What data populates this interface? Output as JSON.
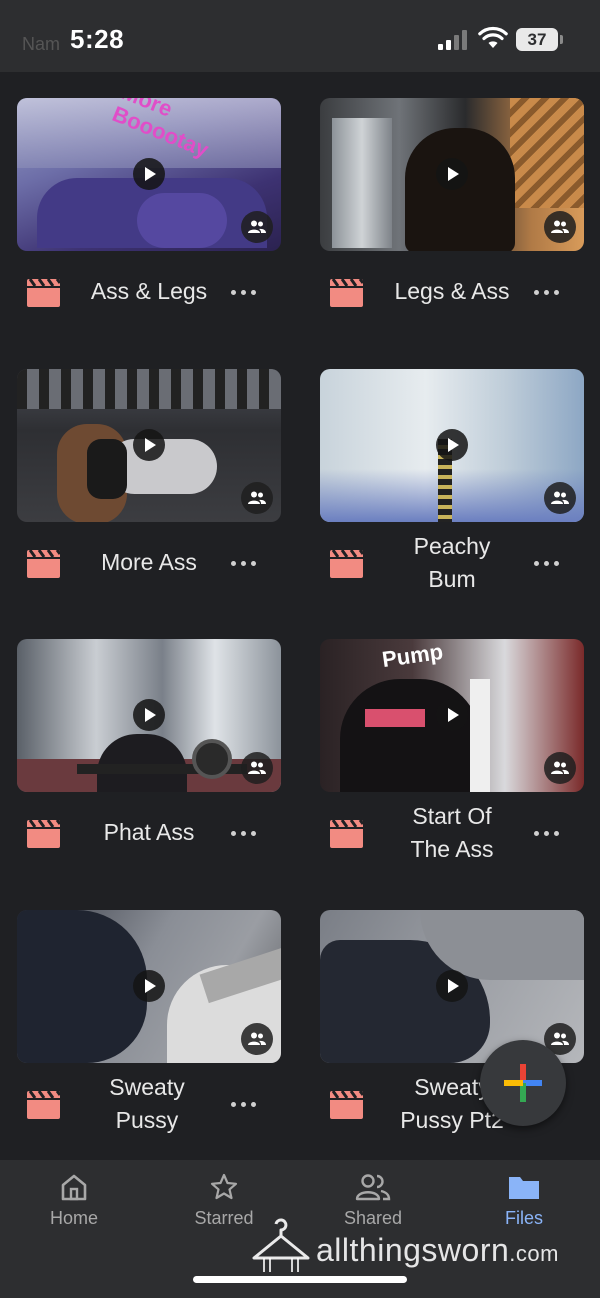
{
  "status_bar": {
    "time": "5:28",
    "battery": "37",
    "ghost_text": "Nam"
  },
  "files": [
    {
      "title": "Ass & Legs",
      "thumb_caption": "More Booootay",
      "icon": "video-file-icon"
    },
    {
      "title": "Legs & Ass",
      "thumb_caption": "",
      "icon": "video-file-icon"
    },
    {
      "title": "More Ass",
      "thumb_caption": "",
      "icon": "video-file-icon"
    },
    {
      "title": "Peachy Bum",
      "thumb_caption": "",
      "icon": "video-file-icon"
    },
    {
      "title": "Phat Ass",
      "thumb_caption": "",
      "icon": "video-file-icon"
    },
    {
      "title": "Start Of The Ass",
      "thumb_caption": "Pump",
      "icon": "video-file-icon"
    },
    {
      "title": "Sweaty Pussy",
      "thumb_caption": "",
      "icon": "video-file-icon"
    },
    {
      "title": "Sweaty Pussy Pt2",
      "thumb_caption": "",
      "icon": "video-file-icon"
    }
  ],
  "nav": {
    "home": "Home",
    "starred": "Starred",
    "shared": "Shared",
    "files": "Files",
    "active": "files"
  },
  "watermark": {
    "brand": "allthingsworn",
    "tld": ".com"
  },
  "colors": {
    "background": "#1f2023",
    "bar": "#2d2e30",
    "file_icon": "#f28b82",
    "accent": "#8ab4f8"
  }
}
